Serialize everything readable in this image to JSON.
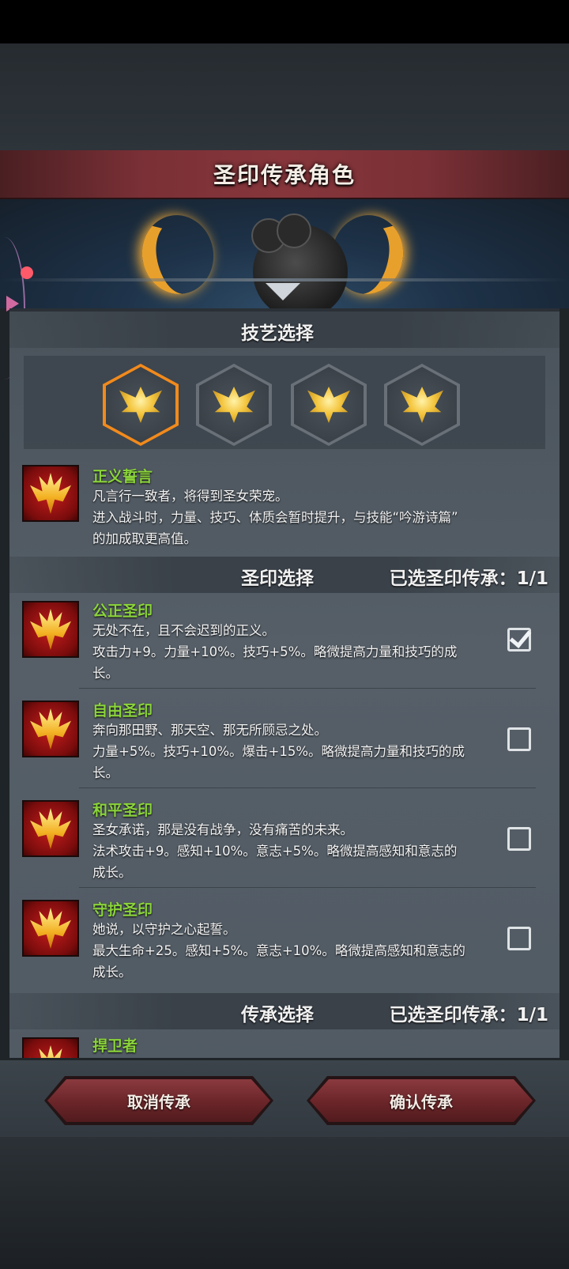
{
  "title": "圣印传承角色",
  "skill_section": {
    "title": "技艺选择"
  },
  "skills": [
    {
      "icon": "golden-crest-icon",
      "selected": true
    },
    {
      "icon": "golden-crest-icon",
      "selected": false
    },
    {
      "icon": "golden-crest-icon",
      "selected": false
    },
    {
      "icon": "golden-crest-icon",
      "selected": false
    }
  ],
  "current_skill": {
    "name": "正义誓言",
    "desc": "凡言行一致者，将得到圣女荣宠。\n进入战斗时，力量、技巧、体质会暂时提升，与技能“吟游诗篇”\n的加成取更高值。"
  },
  "seal_section": {
    "title": "圣印选择",
    "count": "已选圣印传承：1/1"
  },
  "seals": [
    {
      "name": "公正圣印",
      "desc": "无处不在，且不会迟到的正义。\n攻击力+9。力量+10%。技巧+5%。略微提高力量和技巧的成\n长。",
      "checked": true
    },
    {
      "name": "自由圣印",
      "desc": "奔向那田野、那天空、那无所顾忌之处。\n力量+5%。技巧+10%。爆击+15%。略微提高力量和技巧的成\n长。",
      "checked": false
    },
    {
      "name": "和平圣印",
      "desc": "圣女承诺，那是没有战争，没有痛苦的未来。\n法术攻击+9。感知+10%。意志+5%。略微提高感知和意志的\n成长。",
      "checked": false
    },
    {
      "name": "守护圣印",
      "desc": "她说，以守护之心起誓。\n最大生命+25。感知+5%。意志+10%。略微提高感知和意志的\n成长。",
      "checked": false
    }
  ],
  "inherit_section": {
    "title": "传承选择",
    "count": "已选圣印传承：1/1"
  },
  "inherit_items": [
    {
      "name": "捍卫者"
    }
  ],
  "buttons": {
    "cancel": "取消传承",
    "confirm": "确认传承"
  },
  "colors": {
    "accent": "#f28a1c",
    "name_green": "#8bd43a",
    "button_red": "#6a2529"
  }
}
